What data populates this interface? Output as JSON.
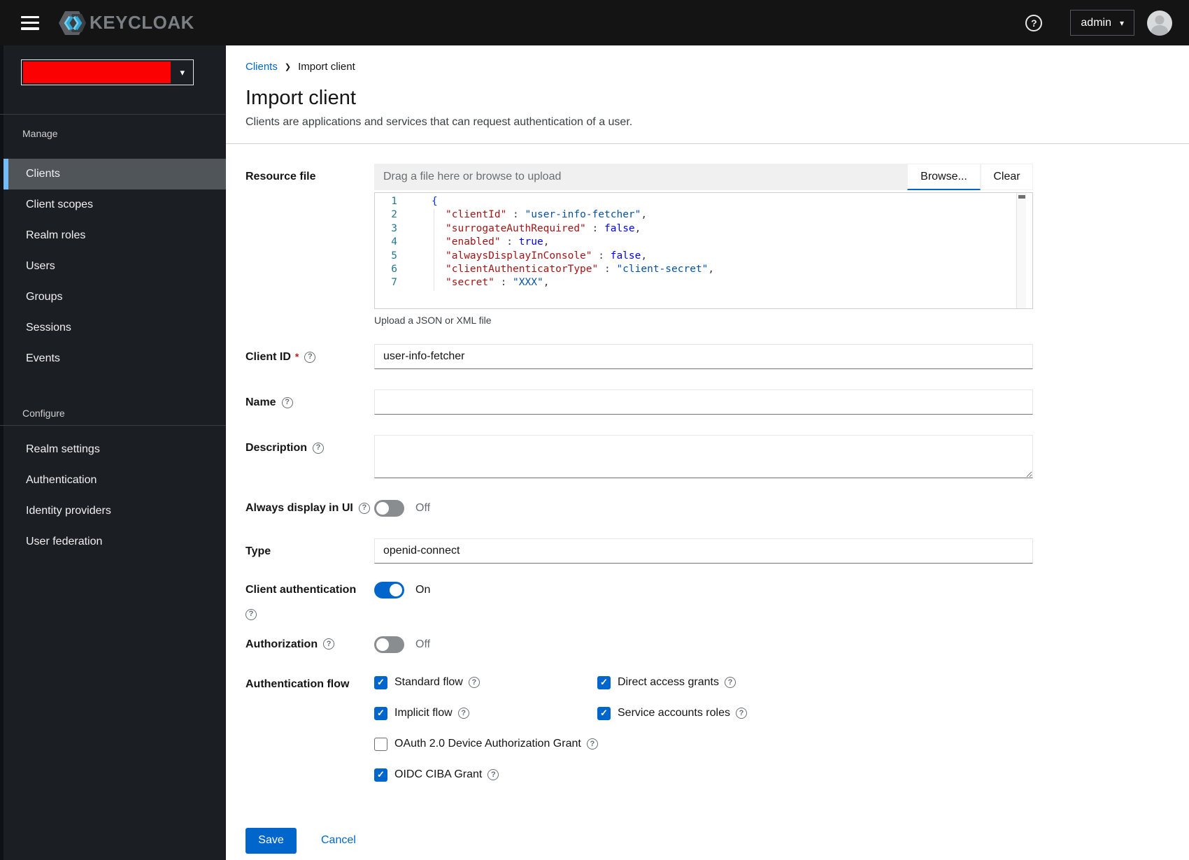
{
  "colors": {
    "accent": "#0066cc",
    "nav_selected_bar": "#73bcf7",
    "realm_redaction": "#fb0101"
  },
  "icons": {
    "help": "?",
    "chevron_down": "▾",
    "breadcrumb_chevron": "❯",
    "check": "✓"
  },
  "header": {
    "brand": "KEYCLOAK",
    "user_label": "admin"
  },
  "sidebar": {
    "manage_title": "Manage",
    "manage_items": [
      "Clients",
      "Client scopes",
      "Realm roles",
      "Users",
      "Groups",
      "Sessions",
      "Events"
    ],
    "selected_item": "Clients",
    "configure_title": "Configure",
    "configure_items": [
      "Realm settings",
      "Authentication",
      "Identity providers",
      "User federation"
    ]
  },
  "breadcrumb": {
    "items": [
      "Clients",
      "Import client"
    ]
  },
  "page": {
    "title": "Import client",
    "subtitle": "Clients are applications and services that can request authentication of a user."
  },
  "form": {
    "resource_file": {
      "label": "Resource file",
      "placeholder": "Drag a file here or browse to upload",
      "browse_label": "Browse...",
      "clear_label": "Clear",
      "helper_text": "Upload a JSON or XML file"
    },
    "code": {
      "lines": [
        {
          "num": "1",
          "text": "{"
        },
        {
          "num": "2",
          "key": "\"clientId\"",
          "sep": " : ",
          "val": "\"user-info-fetcher\"",
          "comma": ","
        },
        {
          "num": "3",
          "key": "\"surrogateAuthRequired\"",
          "sep": " : ",
          "val": "false",
          "comma": ","
        },
        {
          "num": "4",
          "key": "\"enabled\"",
          "sep": " : ",
          "val": "true",
          "comma": ","
        },
        {
          "num": "5",
          "key": "\"alwaysDisplayInConsole\"",
          "sep": " : ",
          "val": "false",
          "comma": ","
        },
        {
          "num": "6",
          "key": "\"clientAuthenticatorType\"",
          "sep": " : ",
          "val": "\"client-secret\"",
          "comma": ","
        },
        {
          "num": "7",
          "key": "\"secret\"",
          "sep": " : ",
          "val": "\"XXX\"",
          "comma": ","
        }
      ]
    },
    "client_id": {
      "label": "Client ID",
      "required_marker": "*",
      "value": "user-info-fetcher"
    },
    "name": {
      "label": "Name",
      "value": ""
    },
    "description": {
      "label": "Description",
      "value": ""
    },
    "always_display_in_ui": {
      "label": "Always display in UI",
      "state_label": "Off"
    },
    "type": {
      "label": "Type",
      "value": "openid-connect"
    },
    "client_authentication": {
      "label": "Client authentication",
      "state_label": "On"
    },
    "authorization": {
      "label": "Authorization",
      "state_label": "Off"
    },
    "authentication_flow": {
      "label": "Authentication flow",
      "options": [
        {
          "label": "Standard flow",
          "checked": true
        },
        {
          "label": "Direct access grants",
          "checked": true
        },
        {
          "label": "Implicit flow",
          "checked": true
        },
        {
          "label": "Service accounts roles",
          "checked": true
        },
        {
          "label": "OAuth 2.0 Device Authorization Grant",
          "checked": false
        },
        {
          "label": "OIDC CIBA Grant",
          "checked": true
        }
      ]
    },
    "actions": {
      "save_label": "Save",
      "cancel_label": "Cancel"
    }
  }
}
